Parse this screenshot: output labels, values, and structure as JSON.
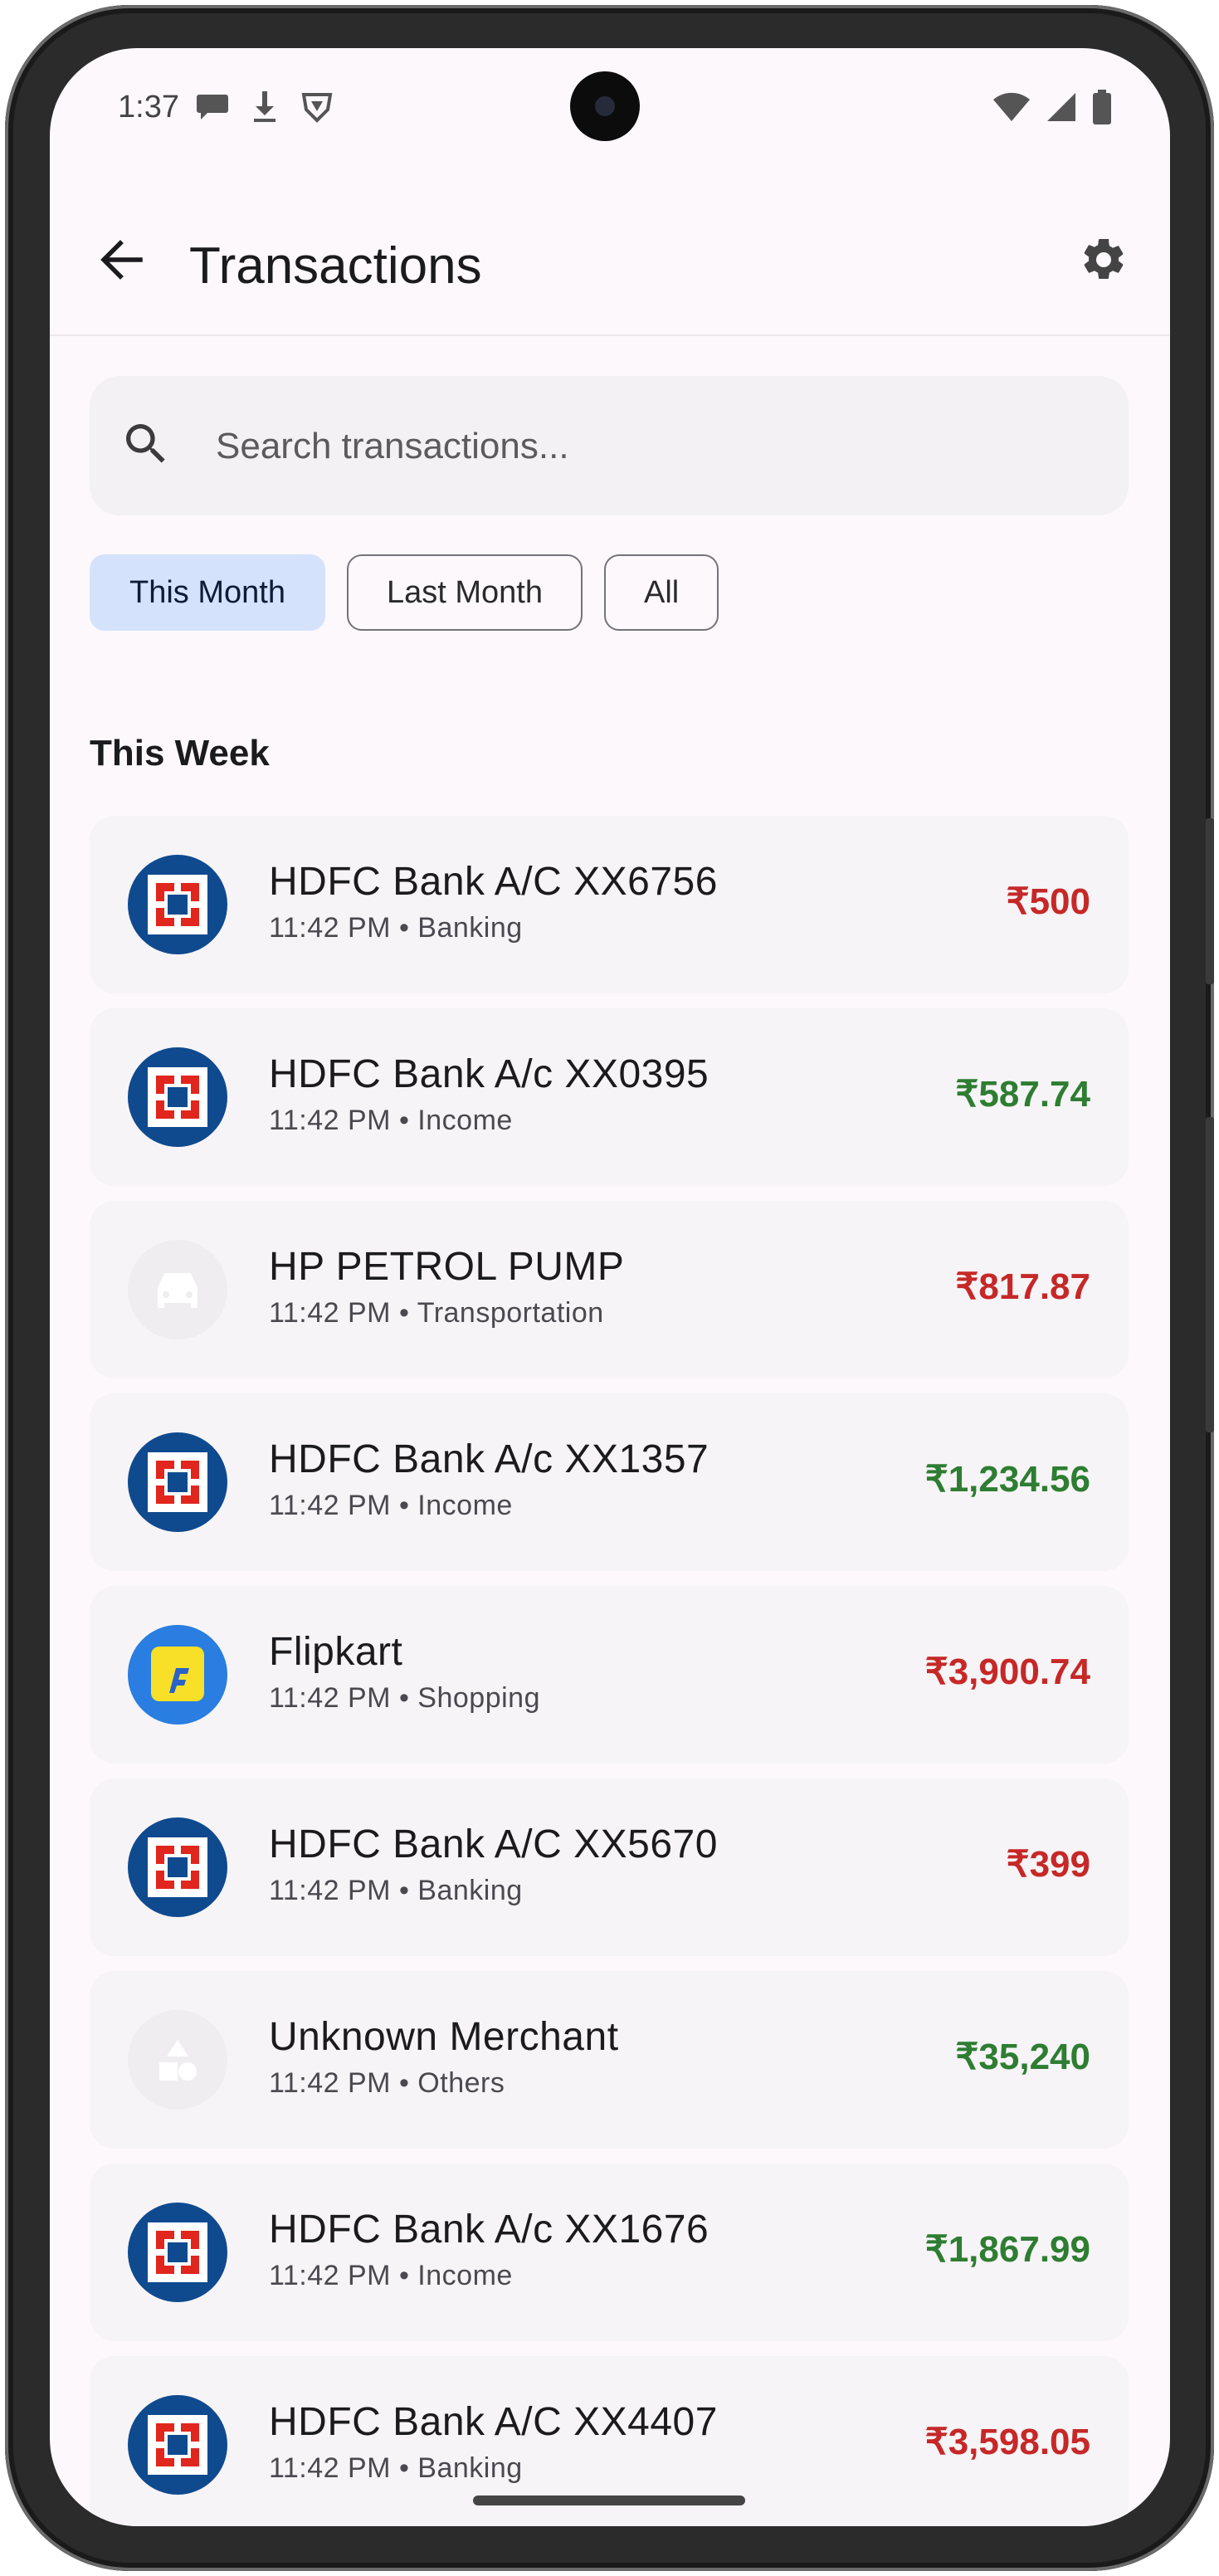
{
  "status_bar": {
    "time": "1:37"
  },
  "app_bar": {
    "title": "Transactions"
  },
  "search": {
    "placeholder": "Search transactions..."
  },
  "filters": [
    {
      "label": "This Month",
      "selected": true
    },
    {
      "label": "Last Month",
      "selected": false
    },
    {
      "label": "All",
      "selected": false
    }
  ],
  "section": {
    "title": "This Week"
  },
  "colors": {
    "debit": "#c62828",
    "credit": "#2e7d32",
    "chip_selected": "#d4e3fb",
    "bank_blue": "#0f4a8f"
  },
  "transactions": [
    {
      "name": "HDFC Bank A/C XX6756",
      "meta": "11:42 PM • Banking",
      "amount": "₹500",
      "type": "debit",
      "icon": "hdfc-bank-logo"
    },
    {
      "name": "HDFC Bank A/c XX0395",
      "meta": "11:42 PM • Income",
      "amount": "₹587.74",
      "type": "credit",
      "icon": "hdfc-bank-logo"
    },
    {
      "name": "HP PETROL PUMP",
      "meta": "11:42 PM • Transportation",
      "amount": "₹817.87",
      "type": "debit",
      "icon": "car-icon"
    },
    {
      "name": "HDFC Bank A/c XX1357",
      "meta": "11:42 PM • Income",
      "amount": "₹1,234.56",
      "type": "credit",
      "icon": "hdfc-bank-logo"
    },
    {
      "name": "Flipkart",
      "meta": "11:42 PM • Shopping",
      "amount": "₹3,900.74",
      "type": "debit",
      "icon": "flipkart-logo"
    },
    {
      "name": "HDFC Bank A/C XX5670",
      "meta": "11:42 PM • Banking",
      "amount": "₹399",
      "type": "debit",
      "icon": "hdfc-bank-logo"
    },
    {
      "name": "Unknown Merchant",
      "meta": "11:42 PM • Others",
      "amount": "₹35,240",
      "type": "credit",
      "icon": "category-shapes-icon"
    },
    {
      "name": "HDFC Bank A/c XX1676",
      "meta": "11:42 PM • Income",
      "amount": "₹1,867.99",
      "type": "credit",
      "icon": "hdfc-bank-logo"
    },
    {
      "name": "HDFC Bank A/C XX4407",
      "meta": "11:42 PM • Banking",
      "amount": "₹3,598.05",
      "type": "debit",
      "icon": "hdfc-bank-logo"
    }
  ]
}
